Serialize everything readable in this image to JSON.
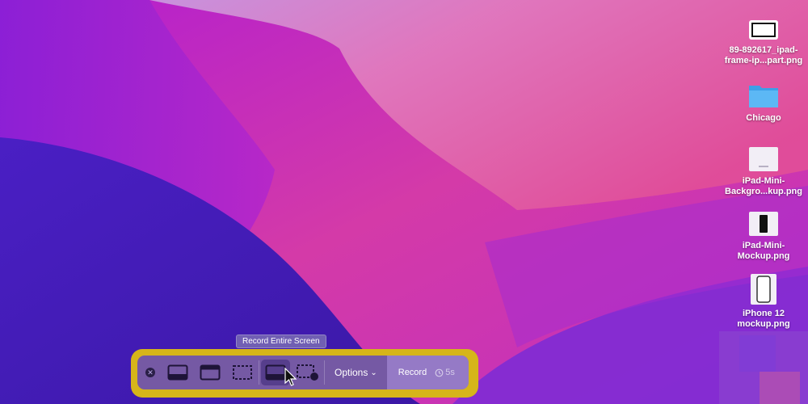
{
  "desktop_icons": [
    {
      "name": "89-892617_ipad-frame-ip...part.png",
      "label": "89-892617_ipad-\nframe-ip...part.png",
      "icon": "image-file-icon"
    },
    {
      "name": "Chicago",
      "label": "Chicago",
      "icon": "folder-icon"
    },
    {
      "name": "iPad-Mini-Backgro...kup.png",
      "label": "iPad-Mini-\nBackgro...kup.png",
      "icon": "image-file-icon"
    },
    {
      "name": "iPad-Mini-Mockup.png",
      "label": "iPad-Mini-\nMockup.png",
      "icon": "image-file-icon"
    },
    {
      "name": "iPhone 12 mockup.png",
      "label": "iPhone 12\nmockup.png",
      "icon": "image-file-icon"
    }
  ],
  "tooltip": "Record Entire Screen",
  "toolbar": {
    "close_icon": "close-icon",
    "tools": [
      {
        "id": "capture-entire-screen",
        "icon": "capture-entire-screen-icon",
        "selected": false
      },
      {
        "id": "capture-selected-window",
        "icon": "capture-window-icon",
        "selected": false
      },
      {
        "id": "capture-selected-portion",
        "icon": "capture-portion-icon",
        "selected": false
      },
      {
        "id": "record-entire-screen",
        "icon": "record-entire-screen-icon",
        "selected": true
      },
      {
        "id": "record-selected-portion",
        "icon": "record-portion-icon",
        "selected": false
      }
    ],
    "options_label": "Options",
    "record_label": "Record",
    "timer_label": "5s"
  },
  "colors": {
    "highlight": "#d6b51a",
    "toolbar_bg": "#6e52af"
  }
}
